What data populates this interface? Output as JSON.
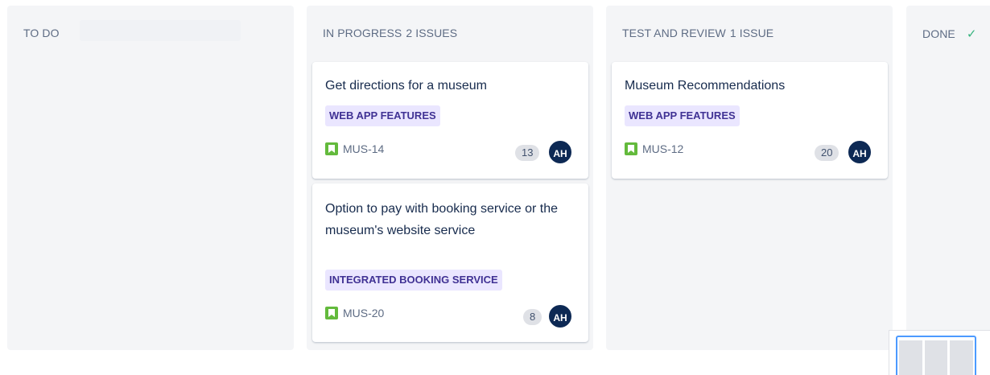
{
  "columns": {
    "todo": {
      "title": "TO DO",
      "count": ""
    },
    "in_progress": {
      "title": "IN PROGRESS",
      "count": "2 ISSUES",
      "cards": [
        {
          "title": "Get directions for a museum",
          "epic": "WEB APP FEATURES",
          "key": "MUS-14",
          "estimate": "13",
          "assignee": "AH",
          "issue_type_icon": "story-icon"
        },
        {
          "title": "Option to pay with booking service or the museum's website service",
          "epic": "INTEGRATED BOOKING SERVICE",
          "key": "MUS-20",
          "estimate": "8",
          "assignee": "AH",
          "issue_type_icon": "story-icon"
        }
      ]
    },
    "test_review": {
      "title": "TEST AND REVIEW",
      "count": "1 ISSUE",
      "cards": [
        {
          "title": "Museum Recommendations",
          "epic": "WEB APP FEATURES",
          "key": "MUS-12",
          "estimate": "20",
          "assignee": "AH",
          "issue_type_icon": "story-icon"
        }
      ]
    },
    "done": {
      "title": "DONE",
      "status_icon": "checkmark-icon"
    }
  },
  "colors": {
    "column_bg": "#f4f5f7",
    "epic_bg": "#eae6ff",
    "epic_text": "#403294",
    "story_green": "#63ba3c",
    "avatar_bg": "#0d2954",
    "done_check": "#36b37e"
  }
}
